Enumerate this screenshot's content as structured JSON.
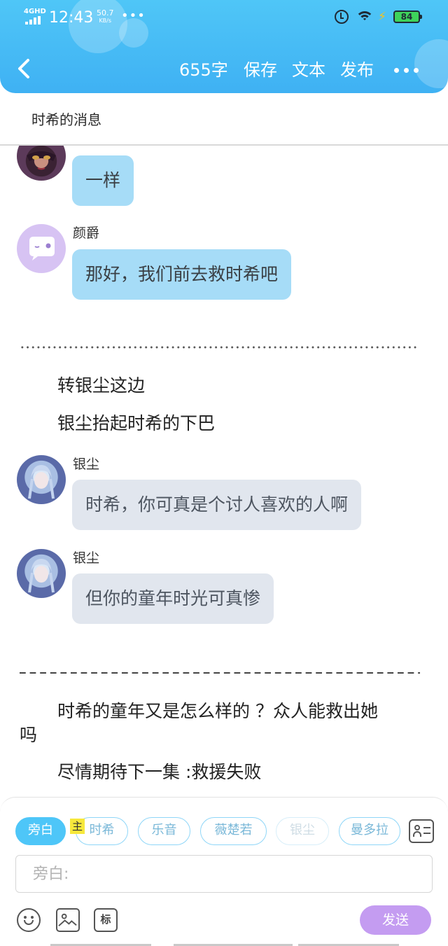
{
  "status_bar": {
    "network": "4GHD",
    "time": "12:43",
    "speed_value": "50.7",
    "speed_unit": "KB/s",
    "dots": "•••",
    "battery": "84"
  },
  "toolbar": {
    "back_icon": "chevron-left-icon",
    "word_count": "655字",
    "save_label": "保存",
    "text_label": "文本",
    "publish_label": "发布",
    "more_icon": "more-dots-icon"
  },
  "title": "时希的消息",
  "messages": [
    {
      "speaker": "",
      "text": "一样",
      "style": "blue"
    },
    {
      "speaker": "颜爵",
      "text": "那好，我们前去救时希吧",
      "style": "blue"
    },
    {
      "speaker": "银尘",
      "text": "时希，你可真是个讨人喜欢的人啊",
      "style": "gray"
    },
    {
      "speaker": "银尘",
      "text": "但你的童年时光可真惨",
      "style": "gray"
    }
  ],
  "narration": {
    "line1": "转银尘这边",
    "line2": "银尘抬起时希的下巴",
    "line3a": "时希的童年又是怎么样的 ？众人能救出她",
    "line3b": "吗",
    "line4": "尽情期待下一集 :救援失败"
  },
  "chips": [
    {
      "label": "旁白",
      "state": "active"
    },
    {
      "label": "时希",
      "state": "normal"
    },
    {
      "label": "乐音",
      "state": "normal"
    },
    {
      "label": "薇楚若",
      "state": "normal"
    },
    {
      "label": "银尘",
      "state": "disabled"
    },
    {
      "label": "曼多拉",
      "state": "normal"
    }
  ],
  "chip_badge": "主",
  "input": {
    "placeholder": "旁白:",
    "value": ""
  },
  "tools": {
    "emoji_icon": "smile-icon",
    "image_icon": "image-icon",
    "tag_label": "标"
  },
  "send_label": "发送",
  "colors": {
    "header": "#3fb1f3",
    "bubble_blue": "#a6dcf7",
    "bubble_gray": "#e1e6ee",
    "chip_active": "#4ec6f8",
    "send_button": "#c49cf1",
    "badge": "#f7e83c"
  }
}
